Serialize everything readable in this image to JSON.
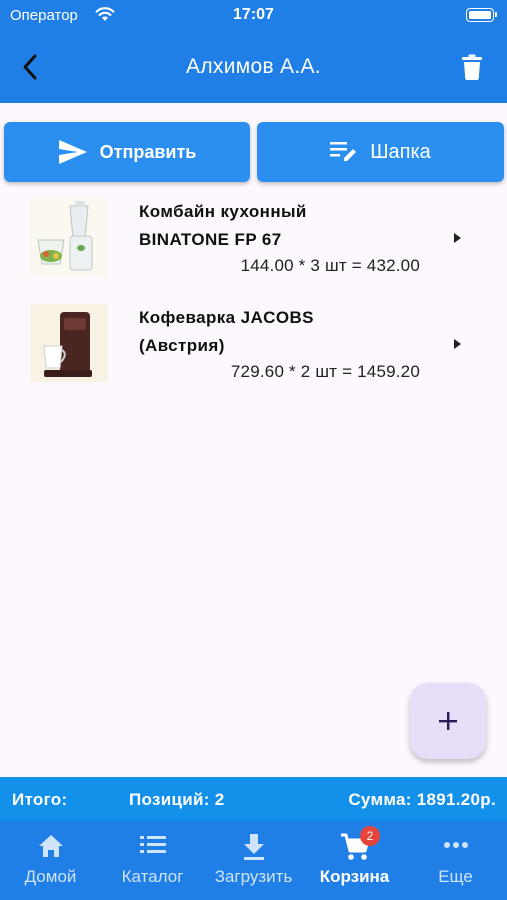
{
  "status_bar": {
    "carrier": "Оператор",
    "time": "17:07"
  },
  "header": {
    "title": "Алхимов А.А."
  },
  "actions": {
    "send_label": "Отправить",
    "header_label": "Шапка"
  },
  "items": [
    {
      "name_line1": "Комбайн кухонный",
      "name_line2": "BINATONE FP 67",
      "price": "144.00 * 3 шт = 432.00"
    },
    {
      "name_line1": "Кофеварка JACOBS",
      "name_line2": "(Австрия)",
      "price": "729.60 * 2 шт = 1459.20"
    }
  ],
  "summary": {
    "total_label": "Итого:",
    "positions": "Позиций: 2",
    "amount": "Сумма: 1891.20р."
  },
  "tabs": [
    {
      "label": "Домой",
      "icon": "home-icon"
    },
    {
      "label": "Каталог",
      "icon": "list-icon"
    },
    {
      "label": "Загрузить",
      "icon": "download-icon"
    },
    {
      "label": "Корзина",
      "icon": "cart-icon",
      "badge": "2",
      "active": true
    },
    {
      "label": "Еще",
      "icon": "more-icon"
    }
  ],
  "colors": {
    "primary": "#1f7fe6",
    "button": "#2b8ff0",
    "summary": "#1290ea",
    "fab": "#e7defa",
    "badge": "#e5453b"
  }
}
